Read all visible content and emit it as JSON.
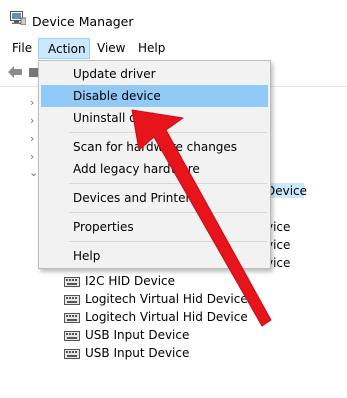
{
  "window": {
    "title": "Device Manager",
    "icon": "device-manager-icon"
  },
  "menubar": {
    "items": [
      "File",
      "Action",
      "View",
      "Help"
    ],
    "active": "Action"
  },
  "action_menu": {
    "items": [
      "Update driver",
      "Disable device",
      "Uninstall device",
      "Scan for hardware changes",
      "Add legacy hardware",
      "Devices and Printers",
      "Properties",
      "Help"
    ],
    "highlighted": "Disable device"
  },
  "tree_peek": [
    "Device",
    "vice",
    "vice",
    "vice"
  ],
  "devices": [
    "I2C HID Device",
    "Logitech Virtual Hid Device",
    "Logitech Virtual Hid Device",
    "USB Input Device",
    "USB Input Device"
  ],
  "colors": {
    "menu_highlight": "#91c9f7",
    "menubar_active": "#cce8ff",
    "annotation_arrow": "#e8141b"
  }
}
